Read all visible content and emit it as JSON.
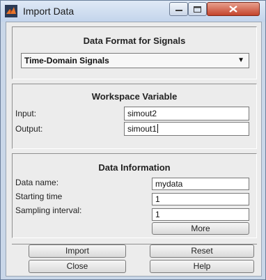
{
  "window": {
    "title": "Import Data",
    "icon": "matlab-icon",
    "controls": [
      "minimize-icon",
      "maximize-icon",
      "close-icon"
    ],
    "close_color": "#c4442c"
  },
  "data_format": {
    "heading": "Data Format for Signals",
    "selected": "Time-Domain Signals"
  },
  "workspace": {
    "heading": "Workspace Variable",
    "input_label": "Input:",
    "input_value": "simout2",
    "output_label": "Output:",
    "output_value": "simout1"
  },
  "info": {
    "heading": "Data Information",
    "name_label": "Data name:",
    "name_value": "mydata",
    "start_label": "Starting time",
    "start_value": "1",
    "interval_label": "Sampling interval:",
    "interval_value": "1",
    "more_label": "More"
  },
  "buttons": {
    "import": "Import",
    "reset": "Reset",
    "close": "Close",
    "help": "Help"
  }
}
